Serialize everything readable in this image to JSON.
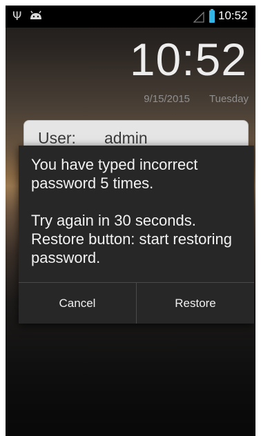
{
  "statusbar": {
    "time": "10:52",
    "icons": [
      "usb-icon",
      "android-icon",
      "signal-icon",
      "battery-icon"
    ]
  },
  "lockscreen": {
    "clock": "10:52",
    "date": "9/15/2015",
    "weekday": "Tuesday",
    "user_label": "User:",
    "user_value": "admin"
  },
  "dialog": {
    "message_line1": "You have typed incorrect password 5 times.",
    "message_line2": "Try again in 30 seconds. Restore button: start restoring password.",
    "cancel_label": "Cancel",
    "restore_label": "Restore"
  },
  "colors": {
    "accent": "#33b5e5",
    "dialog_bg": "#272727",
    "text": "#f2f2f2"
  }
}
